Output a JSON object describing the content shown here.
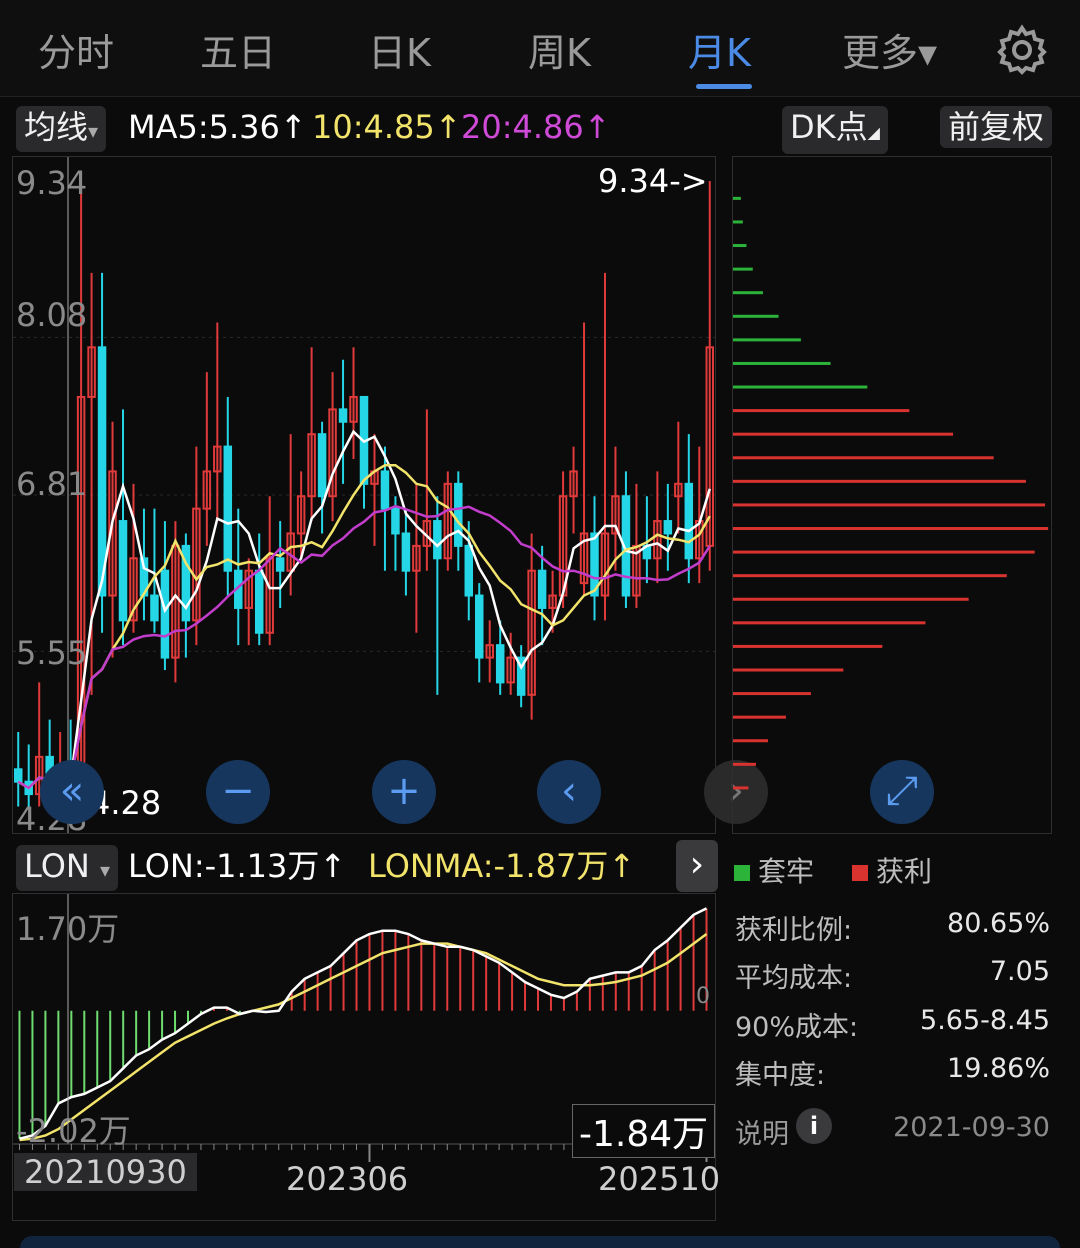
{
  "tabs": [
    {
      "label": "分时",
      "active": false
    },
    {
      "label": "五日",
      "active": false
    },
    {
      "label": "日K",
      "active": false
    },
    {
      "label": "周K",
      "active": false
    },
    {
      "label": "月K",
      "active": true
    },
    {
      "label": "更多▾",
      "active": false
    }
  ],
  "indicator_bar": {
    "ma_selector": "均线",
    "ma5": "MA5:5.36↑",
    "ma10": "10:4.85↑",
    "ma20": "20:4.86↑",
    "dk_button": "DK点",
    "adjust_button": "前复权"
  },
  "colors": {
    "up": "#e03a3a",
    "down": "#25d6e6",
    "ma5": "#ffffff",
    "ma10": "#f2e36b",
    "ma20": "#c23dcc",
    "trapped": "#2cb33a",
    "profit": "#d8332f",
    "accent": "#4b8be6"
  },
  "price_axis": {
    "ticks": [
      "9.34",
      "8.08",
      "6.81",
      "5.55",
      "4.28"
    ],
    "high_marker": "9.34->",
    "low_marker": "4.28"
  },
  "chart_controls": [
    "«",
    "−",
    "+",
    "‹",
    "›",
    "⤢"
  ],
  "lon_bar": {
    "selector": "LON",
    "lon": "LON:-1.13万↑",
    "lonma": "LONMA:-1.87万↑",
    "expand": "›",
    "ticks": [
      "1.70万",
      "0",
      "-2.02万"
    ],
    "current": "-1.84万"
  },
  "dates": {
    "cursor": "20210930",
    "mid": "202306",
    "end": "202510"
  },
  "chip": {
    "legend_trapped": "套牢",
    "legend_profit": "获利",
    "stats": [
      {
        "label": "获利比例:",
        "value": "80.65%"
      },
      {
        "label": "平均成本:",
        "value": "7.05"
      },
      {
        "label": "90%成本:",
        "value": "5.65-8.45"
      },
      {
        "label": "集中度:",
        "value": "19.86%"
      }
    ],
    "explain": "说明",
    "date": "2021-09-30"
  },
  "chart_data": {
    "type": "candlestick",
    "period": "monthly",
    "price_ylim": [
      4.28,
      9.34
    ],
    "grid": true,
    "candles": [
      [
        4.6,
        4.5,
        4.9,
        4.3
      ],
      [
        4.5,
        4.4,
        4.8,
        4.3
      ],
      [
        4.4,
        4.7,
        5.3,
        4.3
      ],
      [
        4.7,
        4.45,
        5.0,
        4.3
      ],
      [
        4.45,
        4.6,
        4.9,
        4.28
      ],
      [
        4.6,
        4.4,
        5.0,
        4.3
      ],
      [
        4.5,
        7.6,
        9.3,
        4.4
      ],
      [
        7.6,
        8.0,
        8.6,
        5.2
      ],
      [
        8.0,
        6.0,
        8.6,
        5.7
      ],
      [
        6.0,
        7.0,
        7.4,
        5.5
      ],
      [
        6.6,
        5.8,
        7.5,
        5.6
      ],
      [
        5.8,
        6.3,
        6.9,
        5.7
      ],
      [
        6.3,
        6.0,
        6.7,
        5.8
      ],
      [
        6.0,
        5.8,
        6.7,
        5.7
      ],
      [
        6.2,
        5.5,
        6.6,
        5.4
      ],
      [
        5.5,
        6.4,
        6.6,
        5.3
      ],
      [
        6.4,
        5.8,
        6.5,
        5.5
      ],
      [
        5.8,
        6.7,
        7.2,
        5.6
      ],
      [
        6.7,
        7.0,
        7.8,
        6.4
      ],
      [
        7.0,
        7.2,
        8.2,
        6.6
      ],
      [
        7.2,
        6.2,
        7.6,
        6.0
      ],
      [
        6.2,
        5.9,
        6.7,
        5.6
      ],
      [
        5.9,
        6.2,
        6.3,
        5.6
      ],
      [
        6.2,
        5.7,
        6.5,
        5.6
      ],
      [
        5.7,
        6.3,
        6.8,
        5.6
      ],
      [
        6.3,
        6.2,
        6.6,
        5.9
      ],
      [
        6.2,
        6.5,
        7.3,
        6.0
      ],
      [
        6.5,
        6.8,
        7.0,
        6.3
      ],
      [
        6.8,
        7.3,
        8.0,
        6.6
      ],
      [
        7.3,
        6.8,
        7.4,
        6.5
      ],
      [
        6.8,
        7.5,
        7.8,
        6.6
      ],
      [
        7.5,
        7.4,
        7.9,
        6.9
      ],
      [
        7.4,
        7.6,
        8.0,
        7.1
      ],
      [
        7.6,
        6.9,
        7.6,
        6.7
      ],
      [
        6.9,
        7.0,
        7.3,
        6.4
      ],
      [
        7.0,
        6.7,
        7.2,
        6.2
      ],
      [
        6.7,
        6.5,
        6.8,
        6.2
      ],
      [
        6.5,
        6.2,
        6.7,
        6.0
      ],
      [
        6.2,
        6.4,
        6.9,
        5.7
      ],
      [
        6.4,
        6.6,
        7.5,
        6.2
      ],
      [
        6.6,
        6.3,
        6.8,
        5.2
      ],
      [
        6.3,
        6.9,
        7.0,
        6.2
      ],
      [
        6.9,
        6.4,
        7.0,
        6.2
      ],
      [
        6.4,
        6.0,
        6.6,
        5.8
      ],
      [
        6.0,
        5.5,
        6.1,
        5.3
      ],
      [
        5.5,
        5.6,
        5.8,
        5.3
      ],
      [
        5.6,
        5.3,
        5.8,
        5.2
      ],
      [
        5.3,
        5.5,
        5.7,
        5.2
      ],
      [
        5.5,
        5.2,
        5.6,
        5.1
      ],
      [
        5.2,
        6.2,
        6.5,
        5.0
      ],
      [
        6.2,
        5.9,
        6.4,
        5.6
      ],
      [
        5.9,
        6.0,
        6.2,
        5.7
      ],
      [
        6.0,
        6.8,
        7.0,
        5.9
      ],
      [
        6.8,
        7.0,
        7.2,
        6.5
      ],
      [
        6.1,
        6.5,
        8.2,
        6.0
      ],
      [
        6.5,
        6.0,
        6.8,
        5.8
      ],
      [
        6.0,
        6.5,
        8.6,
        5.8
      ],
      [
        6.5,
        6.8,
        7.2,
        6.2
      ],
      [
        6.8,
        6.0,
        7.0,
        5.9
      ],
      [
        6.0,
        6.4,
        6.9,
        5.9
      ],
      [
        6.4,
        6.3,
        6.8,
        6.1
      ],
      [
        6.3,
        6.6,
        7.0,
        6.1
      ],
      [
        6.6,
        6.5,
        6.9,
        6.2
      ],
      [
        6.8,
        6.9,
        7.4,
        6.5
      ],
      [
        6.9,
        6.3,
        7.3,
        6.1
      ],
      [
        6.3,
        6.6,
        7.2,
        6.1
      ],
      [
        6.4,
        8.0,
        9.34,
        6.2
      ]
    ],
    "lon_ylim": [
      -2.02,
      1.7
    ],
    "lon_unit": "万",
    "lon_values": [
      -2.0,
      -1.95,
      -1.8,
      -1.45,
      -1.35,
      -1.3,
      -1.2,
      -1.1,
      -0.9,
      -0.7,
      -0.6,
      -0.45,
      -0.35,
      -0.2,
      -0.05,
      0.05,
      0.05,
      -0.05,
      0.0,
      -0.02,
      0.0,
      0.3,
      0.5,
      0.6,
      0.7,
      0.9,
      1.1,
      1.2,
      1.25,
      1.25,
      1.2,
      1.1,
      1.05,
      1.0,
      1.0,
      0.95,
      0.85,
      0.75,
      0.6,
      0.45,
      0.35,
      0.25,
      0.2,
      0.3,
      0.5,
      0.55,
      0.6,
      0.6,
      0.7,
      0.95,
      1.1,
      1.3,
      1.5,
      1.6
    ],
    "lonma_values": [
      -2.02,
      -2.0,
      -1.95,
      -1.85,
      -1.7,
      -1.55,
      -1.4,
      -1.25,
      -1.1,
      -0.95,
      -0.8,
      -0.65,
      -0.5,
      -0.4,
      -0.3,
      -0.2,
      -0.12,
      -0.05,
      0.0,
      0.05,
      0.1,
      0.2,
      0.3,
      0.4,
      0.5,
      0.6,
      0.7,
      0.8,
      0.9,
      0.95,
      1.0,
      1.05,
      1.05,
      1.05,
      1.0,
      0.95,
      0.9,
      0.8,
      0.7,
      0.6,
      0.5,
      0.45,
      0.4,
      0.4,
      0.4,
      0.42,
      0.45,
      0.5,
      0.55,
      0.65,
      0.75,
      0.9,
      1.05,
      1.2
    ]
  }
}
